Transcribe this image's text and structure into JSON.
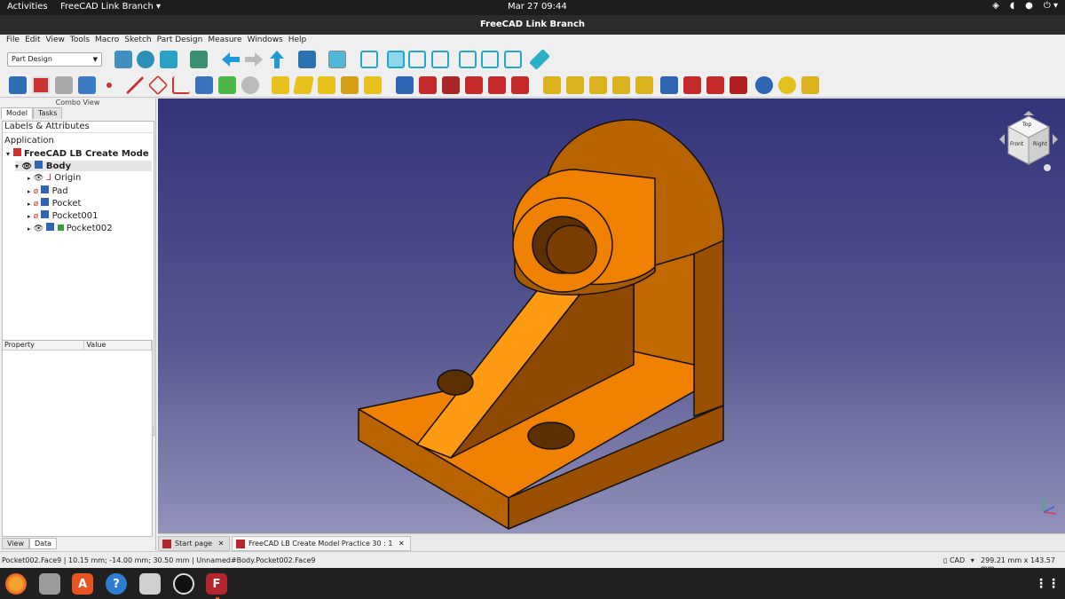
{
  "topbar": {
    "activities": "Activities",
    "app_name": "FreeCAD Link Branch ▾",
    "clock": "Mar 27  09:44",
    "tray_icons": [
      "network-icon",
      "volume-icon",
      "microphone-icon",
      "power-icon"
    ]
  },
  "window": {
    "title": "FreeCAD Link Branch"
  },
  "menu": [
    "File",
    "Edit",
    "View",
    "Tools",
    "Macro",
    "Sketch",
    "Part Design",
    "Measure",
    "Windows",
    "Help"
  ],
  "toolbar": {
    "workbench": "Part Design"
  },
  "combo_view": {
    "title": "Combo View",
    "tabs": [
      "Model",
      "Tasks"
    ],
    "labels_header": "Labels & Attributes",
    "application": "Application",
    "document": "FreeCAD LB Create Mode",
    "body": "Body",
    "items": [
      "Origin",
      "Pad",
      "Pocket",
      "Pocket001",
      "Pocket002"
    ],
    "property_header": [
      "Property",
      "Value"
    ],
    "bottom_tabs": [
      "View",
      "Data"
    ]
  },
  "navcube": {
    "face_top": "Top",
    "face_front": "Front",
    "face_right": "Right"
  },
  "doc_tabs": [
    "Start page",
    "FreeCAD LB Create Model Practice 30 : 1"
  ],
  "status": {
    "message": "Pocket002.Face9 | 10.15 mm; -14.00 mm; 30.50 mm | Unnamed#Body.Pocket002.Face9",
    "nav_style": "CAD",
    "dimensions": "299.21 mm x 143.57 mm"
  },
  "colors": {
    "model": "#f08000",
    "edge": "#111111",
    "accent": "#1b9ec9"
  }
}
